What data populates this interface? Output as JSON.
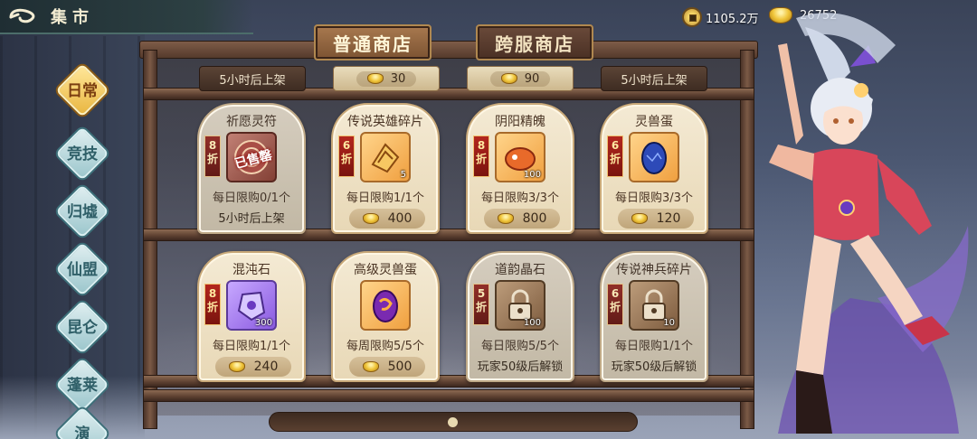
{
  "header": {
    "title": "集市"
  },
  "currencies": {
    "coins": "1105.2万",
    "ingots": "26752"
  },
  "side_nav": [
    {
      "label": "日常",
      "active": true
    },
    {
      "label": "竞技",
      "active": false
    },
    {
      "label": "归墟",
      "active": false
    },
    {
      "label": "仙盟",
      "active": false
    },
    {
      "label": "昆仑",
      "active": false
    },
    {
      "label": "蓬莱",
      "active": false
    },
    {
      "label": "演",
      "active": false
    }
  ],
  "shop_tabs": [
    {
      "label": "普通商店",
      "active": true
    },
    {
      "label": "跨服商店",
      "active": false
    }
  ],
  "top_row": [
    {
      "text": "5小时后上架"
    },
    {
      "price": "30"
    },
    {
      "price": "90"
    },
    {
      "text": "5小时后上架"
    }
  ],
  "row1": [
    {
      "name": "祈愿灵符",
      "discount": "8折",
      "limit": "每日限购0/1个",
      "footer": "5小时后上架",
      "stamp": "已售罄",
      "icon": "talisman-icon"
    },
    {
      "name": "传说英雄碎片",
      "discount": "6折",
      "limit": "每日限购1/1个",
      "price": "400",
      "qty": "5",
      "icon": "hero-fragment-icon"
    },
    {
      "name": "阴阳精魄",
      "discount": "8折",
      "limit": "每日限购3/3个",
      "price": "800",
      "qty": "100",
      "icon": "yinyang-spirit-icon"
    },
    {
      "name": "灵兽蛋",
      "discount": "6折",
      "limit": "每日限购3/3个",
      "price": "120",
      "icon": "beast-egg-icon"
    }
  ],
  "row2": [
    {
      "name": "混沌石",
      "discount": "8折",
      "limit": "每日限购1/1个",
      "price": "240",
      "qty": "300",
      "icon": "chaos-stone-icon"
    },
    {
      "name": "高级灵兽蛋",
      "limit": "每周限购5/5个",
      "price": "500",
      "icon": "advanced-egg-icon"
    },
    {
      "name": "道韵晶石",
      "discount": "5折",
      "limit": "每日限购5/5个",
      "footer": "玩家50级后解锁",
      "qty": "100",
      "icon": "locked-item-icon"
    },
    {
      "name": "传说神兵碎片",
      "discount": "6折",
      "limit": "每日限购1/1个",
      "footer": "玩家50级后解锁",
      "qty": "10",
      "icon": "locked-item-icon"
    }
  ]
}
